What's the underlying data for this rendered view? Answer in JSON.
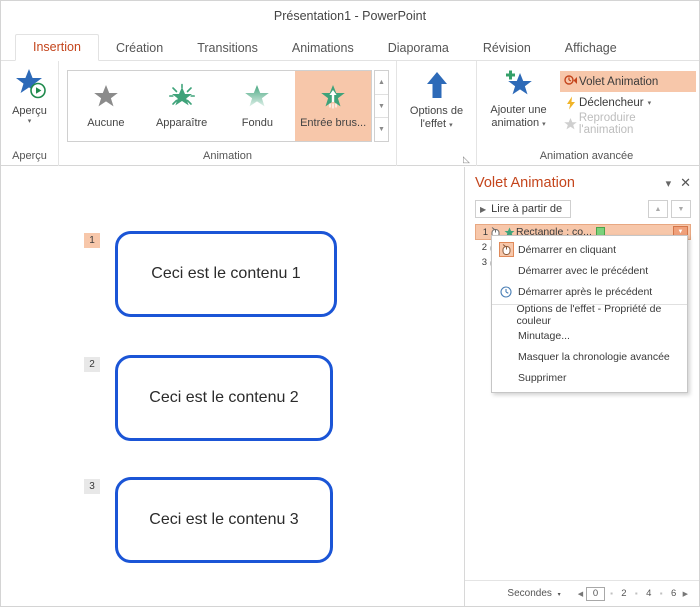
{
  "window": {
    "title": "Présentation1  -  PowerPoint"
  },
  "tabs": [
    {
      "label": "Insertion",
      "active": true
    },
    {
      "label": "Création",
      "active": false
    },
    {
      "label": "Transitions",
      "active": false
    },
    {
      "label": "Animations",
      "active": false
    },
    {
      "label": "Diaporama",
      "active": false
    },
    {
      "label": "Révision",
      "active": false
    },
    {
      "label": "Affichage",
      "active": false
    }
  ],
  "ribbon": {
    "groups": {
      "apercu": {
        "label": "Aperçu",
        "button_label": "Aperçu",
        "icon": "preview-star-play-icon"
      },
      "animation": {
        "label": "Animation",
        "dialog_launcher": "dialog-launcher-icon",
        "gallery": [
          {
            "label": "Aucune",
            "icon": "star-gray-icon",
            "selected": false
          },
          {
            "label": "Apparaître",
            "icon": "star-burst-green-icon",
            "selected": false
          },
          {
            "label": "Fondu",
            "icon": "star-fade-green-icon",
            "selected": false
          },
          {
            "label": "Entrée brus...",
            "icon": "star-entrance-green-icon",
            "selected": true
          }
        ],
        "scroll": [
          "scroll-up-icon",
          "scroll-down-icon",
          "more-icon"
        ]
      },
      "effet": {
        "button_label_line1": "Options de",
        "button_label_line2": "l'effet",
        "icon": "arrow-up-icon",
        "caret": "▾"
      },
      "avancee": {
        "label": "Animation avancée",
        "add_animation_line1": "Ajouter une",
        "add_animation_line2": "animation",
        "add_animation_icon": "add-star-icon",
        "items": [
          {
            "label": "Volet Animation",
            "icon": "animation-pane-icon",
            "selected": true,
            "disabled": false,
            "caret": ""
          },
          {
            "label": "Déclencheur",
            "icon": "lightning-icon",
            "selected": false,
            "disabled": false,
            "caret": "▾"
          },
          {
            "label": "Reproduire l'animation",
            "icon": "painter-star-icon",
            "selected": false,
            "disabled": true,
            "caret": ""
          }
        ]
      }
    }
  },
  "slide": {
    "shapes": [
      {
        "text": "Ceci est le contenu 1",
        "badge": "1",
        "badge_hot": true
      },
      {
        "text": "Ceci est le contenu 2",
        "badge": "2",
        "badge_hot": false
      },
      {
        "text": "Ceci est le contenu 3",
        "badge": "3",
        "badge_hot": false
      }
    ]
  },
  "animation_pane": {
    "title": "Volet Animation",
    "minimize_icon": "chevron-down-icon",
    "close_icon": "close-icon",
    "play_button": "Lire à partir de",
    "play_icon": "play-triangle-icon",
    "move_up_icon": "move-up-icon",
    "move_down_icon": "move-down-icon",
    "items": [
      {
        "num": "1",
        "label": "Rectangle : co...",
        "selected": true,
        "mouse_icon": "mouse-click-icon",
        "star_icon": "star-green-icon",
        "bar": true
      },
      {
        "num": "2",
        "label": "",
        "selected": false,
        "mouse_icon": "mouse-click-icon",
        "star_icon": "",
        "bar": false
      },
      {
        "num": "3",
        "label": "",
        "selected": false,
        "mouse_icon": "mouse-click-icon",
        "star_icon": "",
        "bar": false
      }
    ],
    "dropdown_icon": "chevron-down-icon",
    "context_menu": [
      {
        "label": "Démarrer en cliquant",
        "icon": "mouse-click-icon",
        "separator": false
      },
      {
        "label": "Démarrer avec le précédent",
        "icon": "",
        "separator": false
      },
      {
        "label": "Démarrer après le précédent",
        "icon": "clock-icon",
        "separator": false
      },
      {
        "label": "Options de l'effet - Propriété de couleur",
        "icon": "",
        "separator": true
      },
      {
        "label": "Minutage...",
        "icon": "",
        "separator": false
      },
      {
        "label": "Masquer la chronologie avancée",
        "icon": "",
        "separator": false
      },
      {
        "label": "Supprimer",
        "icon": "",
        "separator": false
      }
    ],
    "footer": {
      "unit_label": "Secondes",
      "unit_caret": "▾",
      "prev_icon": "timeline-prev-icon",
      "next_icon": "timeline-next-icon",
      "current": "0",
      "ticks": [
        "2",
        "4",
        "6"
      ]
    }
  },
  "colors": {
    "accent": "#c4451c",
    "highlight": "#f7c7aa",
    "shape_border": "#1b55d6",
    "star_green": "#3fa37a"
  }
}
